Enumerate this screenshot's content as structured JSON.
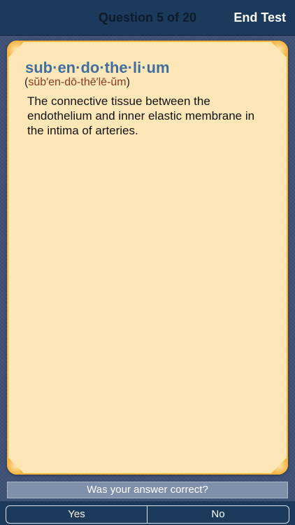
{
  "header": {
    "title": "Question 5 of 20",
    "end_test_label": "End Test"
  },
  "card": {
    "term": "sub·en·do·the·li·um",
    "pronunciation_open": "(",
    "pronunciation": "sŭb′en-dō-thē′lē-ŭm",
    "pronunciation_close": ")",
    "definition": "The connective tissue between the endothelium and inner elastic membrane in the intima of arteries."
  },
  "prompt": {
    "question": "Was your answer correct?"
  },
  "answers": {
    "yes_label": "Yes",
    "no_label": "No"
  },
  "colors": {
    "nav_background": "#1b3a5c",
    "card_background": "#fee7b7",
    "card_border": "#f7b23a",
    "term_color": "#3f6ea1",
    "pronunciation_color": "#8a3a22"
  }
}
